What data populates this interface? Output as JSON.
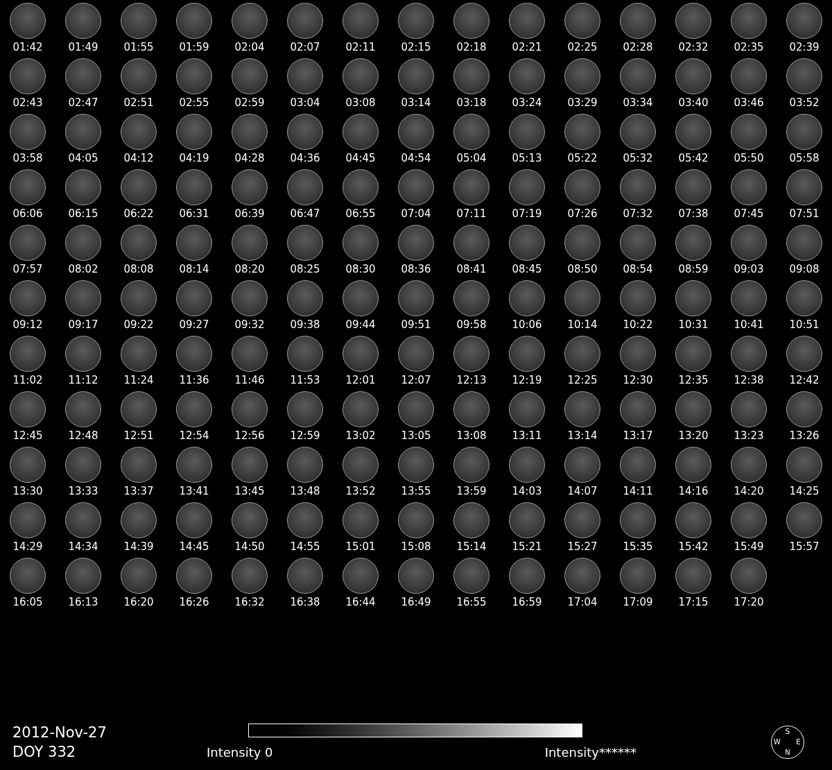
{
  "frames": [
    "01:42",
    "01:49",
    "01:55",
    "01:59",
    "02:04",
    "02:07",
    "02:11",
    "02:15",
    "02:18",
    "02:21",
    "02:25",
    "02:28",
    "02:32",
    "02:35",
    "02:39",
    "02:43",
    "02:47",
    "02:51",
    "02:55",
    "02:59",
    "03:04",
    "03:08",
    "03:14",
    "03:18",
    "03:24",
    "03:29",
    "03:34",
    "03:40",
    "03:46",
    "03:52",
    "03:58",
    "04:05",
    "04:12",
    "04:19",
    "04:28",
    "04:36",
    "04:45",
    "04:54",
    "05:04",
    "05:13",
    "05:22",
    "05:32",
    "05:42",
    "05:50",
    "05:58",
    "06:06",
    "06:15",
    "06:22",
    "06:31",
    "06:39",
    "06:47",
    "06:55",
    "07:04",
    "07:11",
    "07:19",
    "07:26",
    "07:32",
    "07:38",
    "07:45",
    "07:51",
    "07:57",
    "08:02",
    "08:08",
    "08:14",
    "08:20",
    "08:25",
    "08:30",
    "08:36",
    "08:41",
    "08:45",
    "08:50",
    "08:54",
    "08:59",
    "09:03",
    "09:08",
    "09:12",
    "09:17",
    "09:22",
    "09:27",
    "09:32",
    "09:38",
    "09:44",
    "09:51",
    "09:58",
    "10:06",
    "10:14",
    "10:22",
    "10:31",
    "10:41",
    "10:51",
    "11:02",
    "11:12",
    "11:24",
    "11:36",
    "11:46",
    "11:53",
    "12:01",
    "12:07",
    "12:13",
    "12:19",
    "12:25",
    "12:30",
    "12:35",
    "12:38",
    "12:42",
    "12:45",
    "12:48",
    "12:51",
    "12:54",
    "12:56",
    "12:59",
    "13:02",
    "13:05",
    "13:08",
    "13:11",
    "13:14",
    "13:17",
    "13:20",
    "13:23",
    "13:26",
    "13:30",
    "13:33",
    "13:37",
    "13:41",
    "13:45",
    "13:48",
    "13:52",
    "13:55",
    "13:59",
    "14:03",
    "14:07",
    "14:11",
    "14:16",
    "14:20",
    "14:25",
    "14:29",
    "14:34",
    "14:39",
    "14:45",
    "14:50",
    "14:55",
    "15:01",
    "15:08",
    "15:14",
    "15:21",
    "15:27",
    "15:35",
    "15:42",
    "15:49",
    "15:57",
    "16:05",
    "16:13",
    "16:20",
    "16:26",
    "16:32",
    "16:38",
    "16:44",
    "16:49",
    "16:55",
    "16:59",
    "17:04",
    "17:09",
    "17:15",
    "17:20"
  ],
  "date": "2012-Nov-27",
  "doy": "DOY 332",
  "colorbar": {
    "min_label": "Intensity 0",
    "max_label": "Intensity******"
  },
  "compass": {
    "top": "S",
    "left": "W",
    "right": "E",
    "bottom": "N"
  }
}
